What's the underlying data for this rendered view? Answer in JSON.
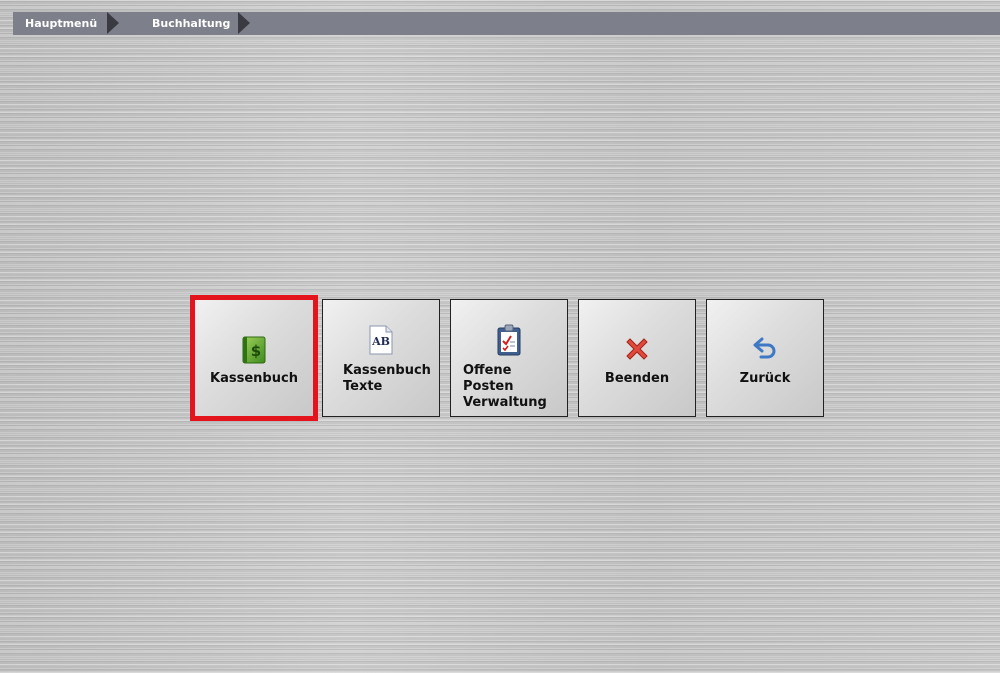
{
  "breadcrumb": {
    "items": [
      "Hauptmenü",
      "Buchhaltung"
    ]
  },
  "tiles": [
    {
      "line1": "Kassenbuch",
      "line2": "",
      "icon": "cashbook-icon",
      "selected": true
    },
    {
      "line1": "Kassenbuch",
      "line2": "Texte",
      "icon": "text-document-icon",
      "selected": false
    },
    {
      "line1": "Offene Posten",
      "line2": "Verwaltung",
      "icon": "clipboard-checklist-icon",
      "selected": false
    },
    {
      "line1": "Beenden",
      "line2": "",
      "icon": "close-x-icon",
      "selected": false
    },
    {
      "line1": "Zurück",
      "line2": "",
      "icon": "back-arrow-icon",
      "selected": false
    }
  ],
  "colors": {
    "selection_border": "#e3141b",
    "breadcrumb_bg": "#7d7f8a"
  }
}
